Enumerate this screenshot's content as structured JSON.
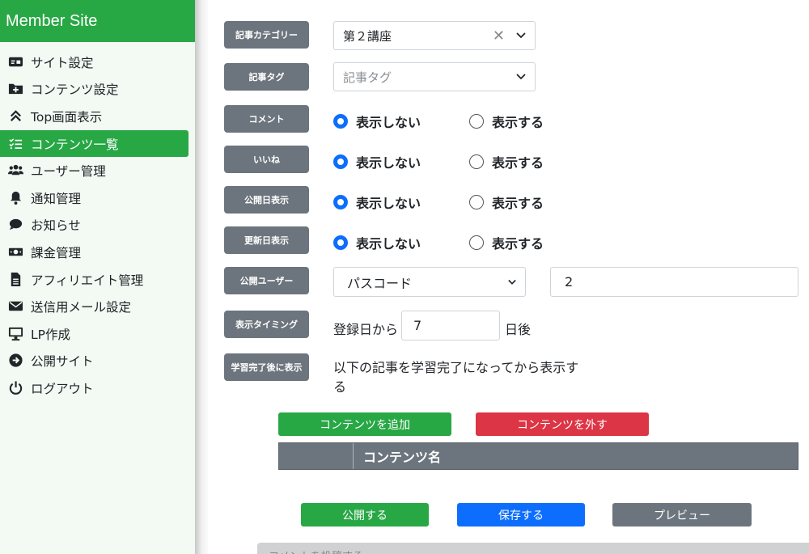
{
  "sidebar": {
    "brand": "Member Site",
    "items": [
      {
        "label": "サイト設定",
        "icon": "id-card-icon"
      },
      {
        "label": "コンテンツ設定",
        "icon": "folder-plus-icon"
      },
      {
        "label": "Top画面表示",
        "icon": "double-chevron-up-icon"
      },
      {
        "label": "コンテンツ一覧",
        "icon": "checklist-icon",
        "active": true
      },
      {
        "label": "ユーザー管理",
        "icon": "users-icon"
      },
      {
        "label": "通知管理",
        "icon": "bell-icon"
      },
      {
        "label": "お知らせ",
        "icon": "speech-bubble-icon"
      },
      {
        "label": "課金管理",
        "icon": "money-bill-icon"
      },
      {
        "label": "アフィリエイト管理",
        "icon": "file-icon"
      },
      {
        "label": "送信用メール設定",
        "icon": "envelope-icon"
      },
      {
        "label": "LP作成",
        "icon": "monitor-icon"
      },
      {
        "label": "公開サイト",
        "icon": "arrow-circle-right-icon"
      },
      {
        "label": "ログアウト",
        "icon": "power-icon"
      }
    ]
  },
  "form": {
    "category": {
      "label": "記事カテゴリー",
      "value": "第２講座"
    },
    "tag": {
      "label": "記事タグ",
      "placeholder": "記事タグ"
    },
    "comment": {
      "label": "コメント"
    },
    "like": {
      "label": "いいね"
    },
    "pubdate": {
      "label": "公開日表示"
    },
    "upddate": {
      "label": "更新日表示"
    },
    "radio_hide": "表示しない",
    "radio_show": "表示する",
    "public_user": {
      "label": "公開ユーザー",
      "select_value": "パスコード",
      "input_value": "2"
    },
    "timing": {
      "label": "表示タイミング",
      "prefix": "登録日から",
      "value": "7",
      "suffix": "日後"
    },
    "after_complete": {
      "label": "学習完了後に表示",
      "text_line1": "以下の記事を学習完了になってから表示す",
      "text_line2": "る"
    }
  },
  "actions": {
    "add_content": "コンテンツを追加",
    "remove_content": "コンテンツを外す",
    "table_header": "コンテンツ名",
    "publish": "公開する",
    "save": "保存する",
    "preview": "プレビュー"
  },
  "bottom_bar_text": "コメントを投稿する",
  "colors": {
    "green": "#28a745",
    "red": "#dc3545",
    "blue": "#0d6efd",
    "gray": "#6c757d"
  }
}
